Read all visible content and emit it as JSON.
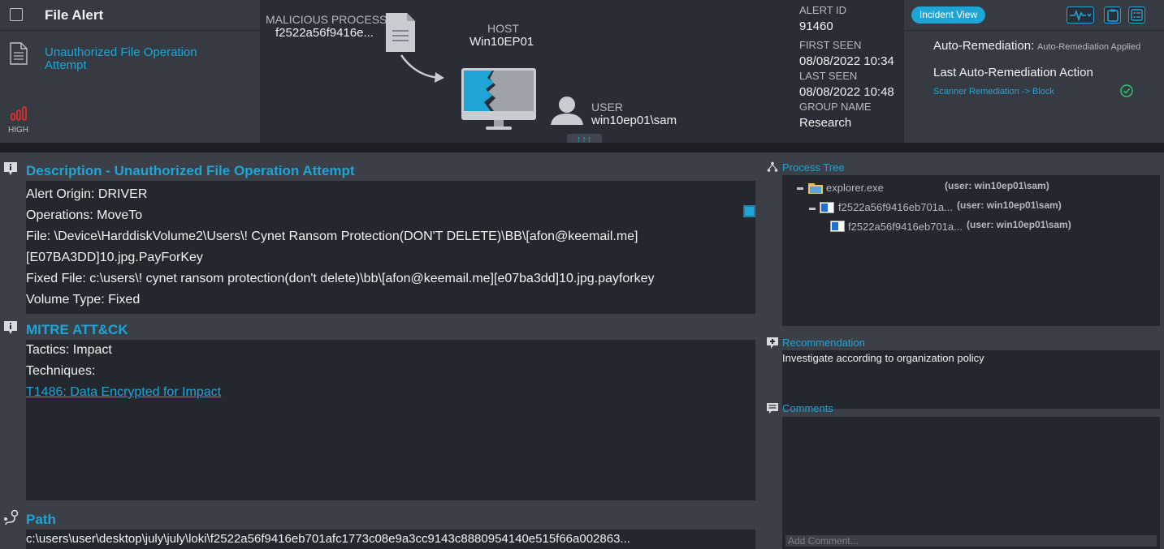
{
  "header": {
    "title": "File Alert",
    "alert_name": "Unauthorized File Operation Attempt",
    "severity": "HIGH",
    "malicious_process_label": "MALICIOUS PROCESS",
    "malicious_process_value": "f2522a56f9416e...",
    "host_label": "HOST",
    "host_value": "Win10EP01",
    "user_label": "USER",
    "user_value": "win10ep01\\sam",
    "expand_glyph": "↑↑↑",
    "alert_id_label": "ALERT ID",
    "alert_id_value": "91460",
    "first_seen_label": "FIRST SEEN",
    "first_seen_value": "08/08/2022 10:34",
    "last_seen_label": "LAST SEEN",
    "last_seen_value": "08/08/2022 10:48",
    "group_label": "GROUP NAME",
    "group_value": "Research",
    "incident_view": "Incident View",
    "auto_remediation_label": "Auto-Remediation:",
    "auto_remediation_value": "Auto-Remediation Applied",
    "last_action_label": "Last Auto-Remediation Action",
    "last_action_value": "Scanner Remediation -> Block",
    "icons": {
      "checkbox": "checkbox",
      "doc": "document-icon",
      "severity": "severity-bars-icon",
      "monitor": "monitor-icon",
      "user": "user-icon",
      "activity": "activity-icon",
      "clipboard": "clipboard-icon",
      "list": "list-icon",
      "check": "check-circle-icon"
    }
  },
  "description": {
    "title": "Description - Unauthorized File Operation Attempt",
    "lines": [
      "Alert Origin: DRIVER",
      "Operations: MoveTo",
      "File: \\Device\\HarddiskVolume2\\Users\\! Cynet Ransom Protection(DON'T DELETE)\\BB\\[afon@keemail.me]",
      "[E07BA3DD]10.jpg.PayForKey",
      "Fixed File: c:\\users\\! cynet ransom protection(don't delete)\\bb\\[afon@keemail.me][e07ba3dd]10.jpg.payforkey",
      "Volume Type: Fixed"
    ]
  },
  "mitre": {
    "title": "MITRE ATT&CK",
    "tactics": "Tactics: Impact",
    "techniques": "Techniques:",
    "technique_link": "T1486: Data Encrypted for Impact"
  },
  "path": {
    "title": "Path",
    "value": "c:\\users\\user\\desktop\\july\\july\\loki\\f2522a56f9416eb701afc1773c08e9a3cc9143c8880954140e515f66a002863..."
  },
  "process_tree": {
    "title": "Process Tree",
    "rows": [
      {
        "name": "explorer.exe",
        "user": "(user: win10ep01\\sam)"
      },
      {
        "name": "f2522a56f9416eb701a...",
        "user": "(user: win10ep01\\sam)"
      },
      {
        "name": "f2522a56f9416eb701a...",
        "user": "(user: win10ep01\\sam)"
      }
    ]
  },
  "recommendation": {
    "title": "Recommendation",
    "text": "Investigate according to organization policy"
  },
  "comments": {
    "title": "Comments",
    "placeholder": "Add Comment..."
  },
  "colors": {
    "accent": "#1ea5d6",
    "severity_high": "#e0302d",
    "success": "#2ecc71"
  }
}
